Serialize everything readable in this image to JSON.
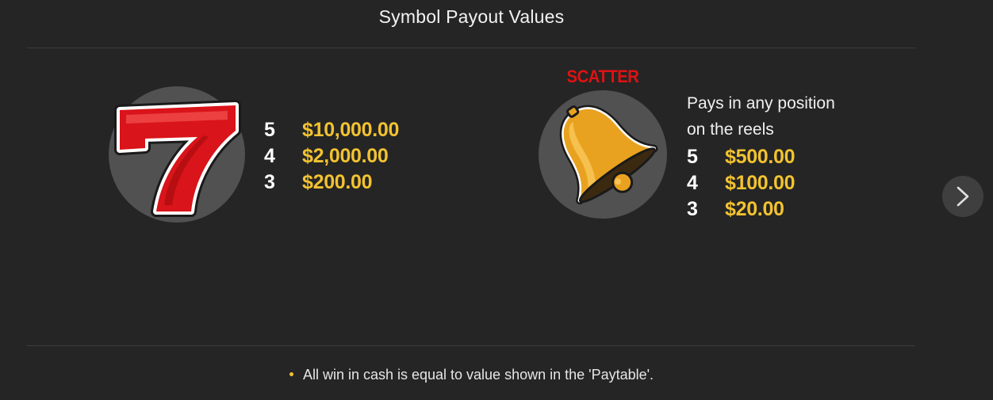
{
  "header": {
    "title": "Symbol Payout Values"
  },
  "symbols": [
    {
      "icon": "seven-icon",
      "payouts": [
        {
          "count": "5",
          "value": "$10,000.00"
        },
        {
          "count": "4",
          "value": "$2,000.00"
        },
        {
          "count": "3",
          "value": "$200.00"
        }
      ]
    },
    {
      "icon": "bell-icon",
      "label": "SCATTER",
      "description_line1": "Pays in any position",
      "description_line2": "on the reels",
      "payouts": [
        {
          "count": "5",
          "value": "$500.00"
        },
        {
          "count": "4",
          "value": "$100.00"
        },
        {
          "count": "3",
          "value": "$20.00"
        }
      ]
    }
  ],
  "navigation": {
    "next_icon": "chevron-right-icon"
  },
  "footer": {
    "note": "All win in cash is equal to value shown in the 'Paytable'."
  },
  "colors": {
    "background": "#252525",
    "payout_value": "#f2c230",
    "scatter_label": "#e01212",
    "symbol_circle": "#515151"
  }
}
